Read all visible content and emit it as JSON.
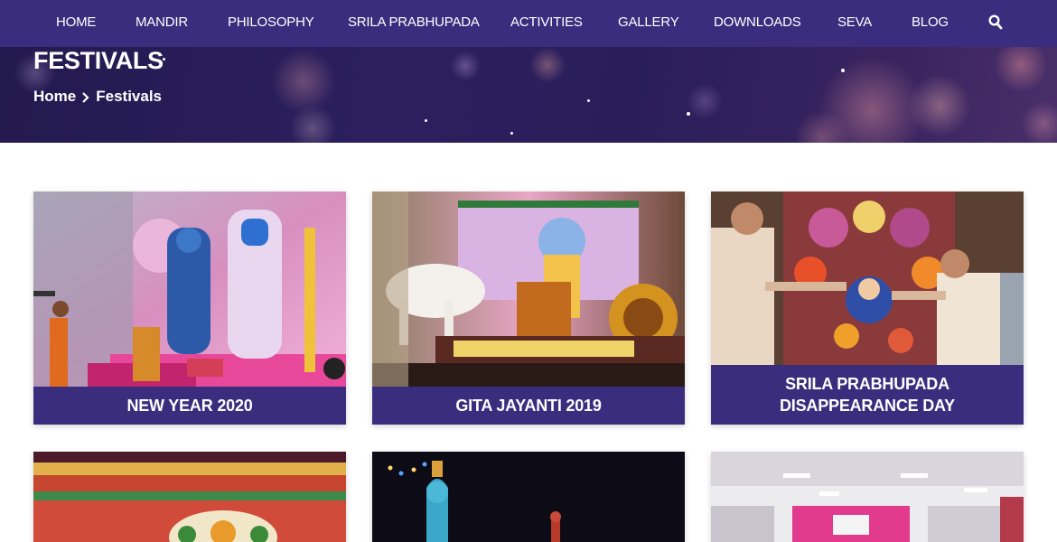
{
  "nav": {
    "items": [
      {
        "label": "HOME"
      },
      {
        "label": "MANDIR"
      },
      {
        "label": "PHILOSOPHY"
      },
      {
        "label": "SRILA PRABHUPADA"
      },
      {
        "label": "ACTIVITIES"
      },
      {
        "label": "GALLERY"
      },
      {
        "label": "DOWNLOADS"
      },
      {
        "label": "SEVA"
      },
      {
        "label": "BLOG"
      }
    ],
    "search_icon": "search-icon"
  },
  "hero": {
    "title": "FESTIVALS",
    "breadcrumb": {
      "home": "Home",
      "separator_icon": "chevron-right-icon",
      "current": "Festivals"
    }
  },
  "festivals": [
    {
      "title": "NEW YEAR 2020"
    },
    {
      "title": "GITA JAYANTI 2019"
    },
    {
      "title": "SRILA PRABHUPADA DISAPPEARANCE DAY"
    },
    {
      "title": ""
    },
    {
      "title": ""
    },
    {
      "title": ""
    }
  ],
  "colors": {
    "brand": "#3a2d7d",
    "hero_bg": "#2b1f5e",
    "text_on_brand": "#ffffff"
  }
}
